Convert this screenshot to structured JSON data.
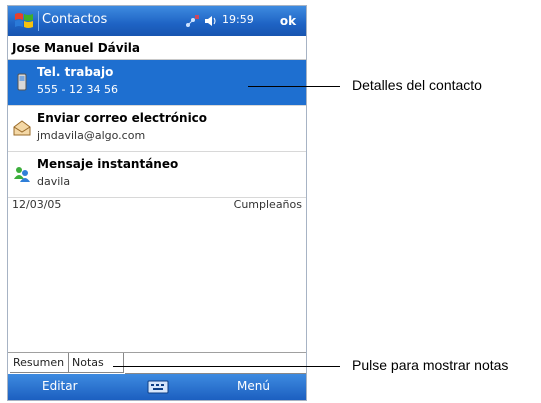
{
  "titlebar": {
    "app_title": "Contactos",
    "clock": "19:59",
    "ok_label": "ok",
    "icons": [
      "windows-start-icon",
      "signal-icon",
      "volume-icon"
    ]
  },
  "contact": {
    "name": "Jose Manuel Dávila",
    "details": [
      {
        "title": "Tel. trabajo",
        "sub": "555 - 12 34 56",
        "icon": "phone-icon",
        "selected": true
      },
      {
        "title": "Enviar correo electrónico",
        "sub": "jmdavila@algo.com",
        "icon": "email-icon",
        "selected": false
      },
      {
        "title": "Mensaje instantáneo",
        "sub": "davila",
        "icon": "messenger-icon",
        "selected": false
      }
    ],
    "birthday_date": "12/03/05",
    "birthday_label": "Cumpleaños"
  },
  "tabs": [
    {
      "label": "Resumen",
      "active": true
    },
    {
      "label": "Notas",
      "active": false
    }
  ],
  "softkeys": {
    "left": "Editar",
    "right": "Menú",
    "center_icon": "keyboard-icon"
  },
  "callouts": {
    "details": "Detalles del contacto",
    "notes": "Pulse para mostrar notas"
  },
  "colors": {
    "titlebar": "#1e63c4",
    "selection": "#1e6fd0"
  }
}
